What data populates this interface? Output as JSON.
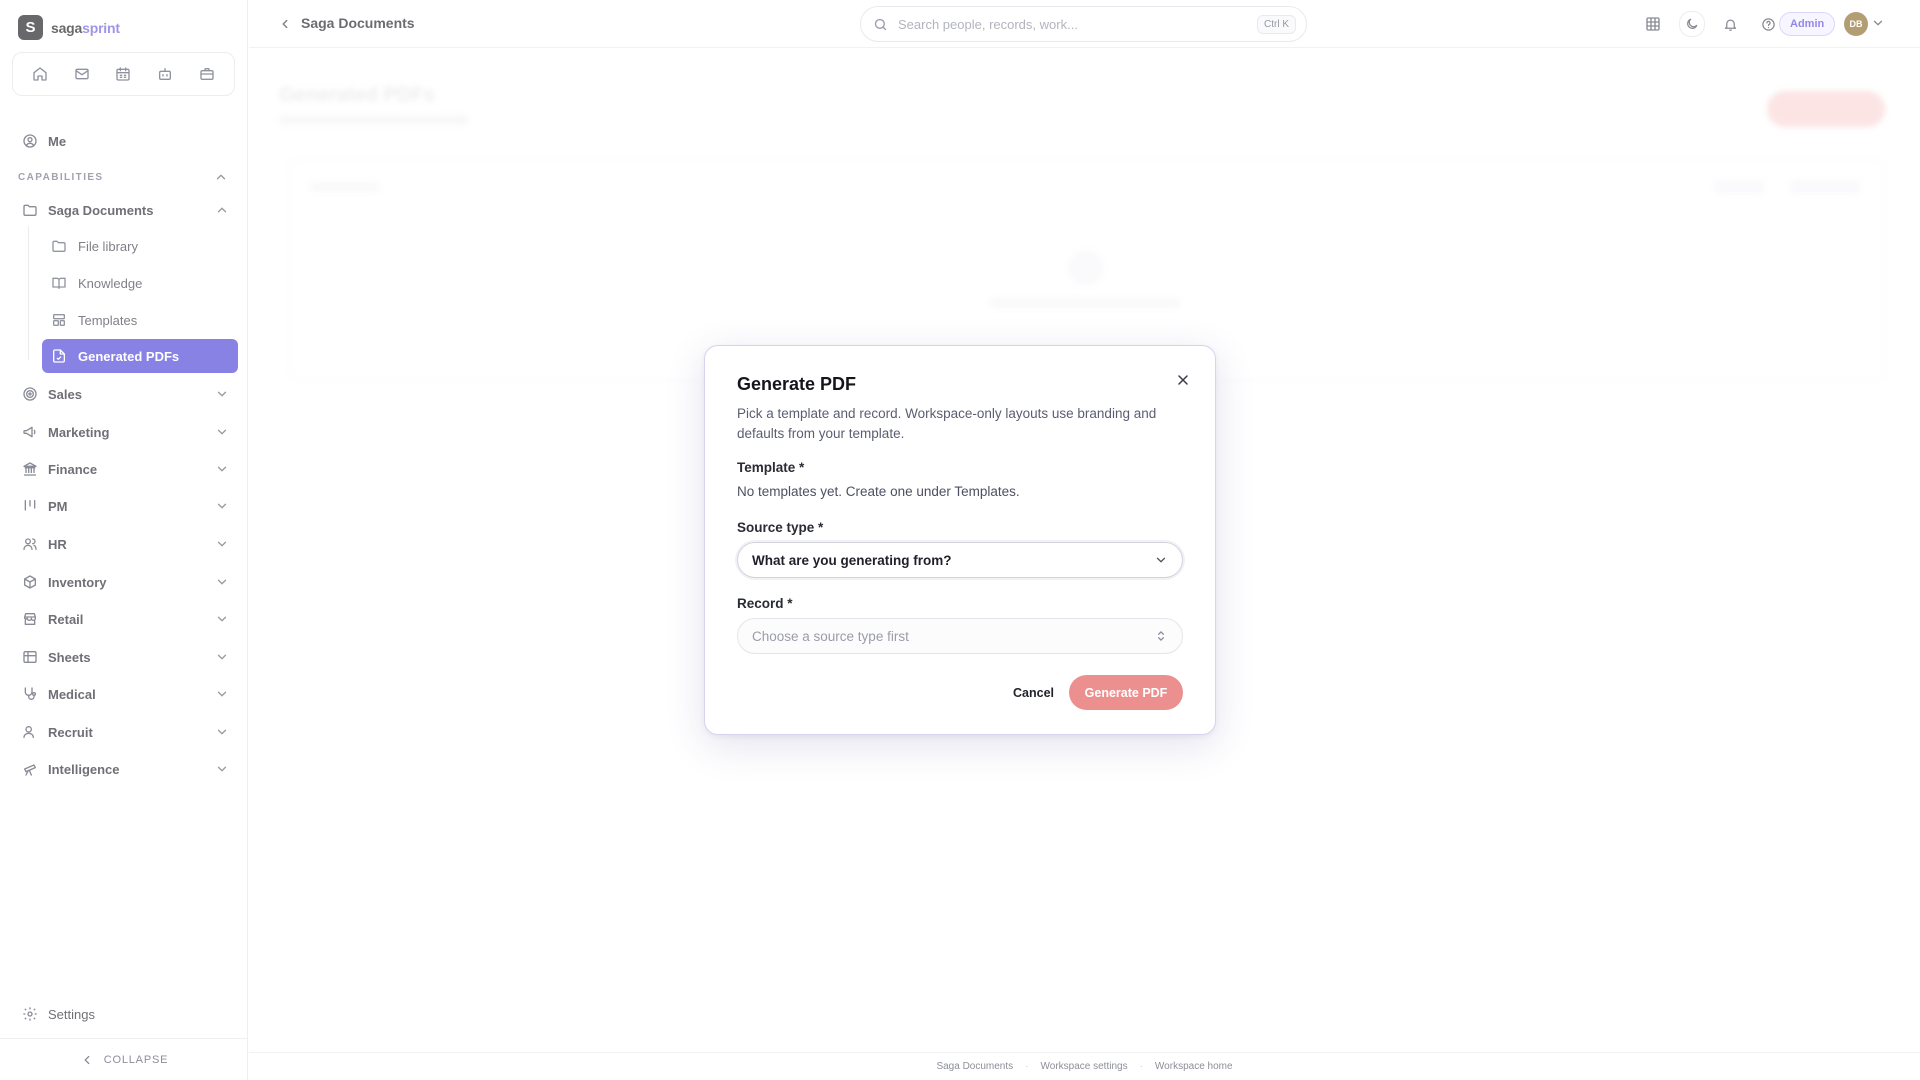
{
  "brand": {
    "mark": "S",
    "name_primary": "saga",
    "name_accent": "sprint"
  },
  "quickbar": {
    "items": [
      {
        "icon": "home-icon"
      },
      {
        "icon": "mail-icon"
      },
      {
        "icon": "calendar-icon"
      },
      {
        "icon": "bot-icon"
      },
      {
        "icon": "briefcase-icon"
      }
    ]
  },
  "sidebar": {
    "me_label": "Me",
    "section_label": "CAPABILITIES",
    "saga_documents_label": "Saga Documents",
    "sub_items": [
      {
        "label": "File library",
        "icon": "folder-icon"
      },
      {
        "label": "Knowledge",
        "icon": "book-icon"
      },
      {
        "label": "Templates",
        "icon": "template-icon"
      },
      {
        "label": "Generated PDFs",
        "icon": "file-pdf-icon",
        "active": true
      }
    ],
    "items": [
      {
        "label": "Sales",
        "icon": "target-icon"
      },
      {
        "label": "Marketing",
        "icon": "megaphone-icon"
      },
      {
        "label": "Finance",
        "icon": "bank-icon"
      },
      {
        "label": "PM",
        "icon": "kanban-icon"
      },
      {
        "label": "HR",
        "icon": "users-icon"
      },
      {
        "label": "Inventory",
        "icon": "package-icon"
      },
      {
        "label": "Retail",
        "icon": "store-icon"
      },
      {
        "label": "Sheets",
        "icon": "table-icon"
      },
      {
        "label": "Medical",
        "icon": "stethoscope-icon"
      },
      {
        "label": "Recruit",
        "icon": "user-plus-icon"
      },
      {
        "label": "Intelligence",
        "icon": "telescope-icon"
      }
    ],
    "settings_label": "Settings",
    "collapse_label": "COLLAPSE"
  },
  "topbar": {
    "title": "Saga Documents",
    "search_placeholder": "Search people, records, work...",
    "search_shortcut": "Ctrl K",
    "admin_label": "Admin",
    "avatar_initials": "DB"
  },
  "background_page": {
    "title": "Generated PDFs"
  },
  "modal": {
    "title": "Generate PDF",
    "description": "Pick a template and record. Workspace-only layouts use branding and defaults from your template.",
    "template_label": "Template *",
    "template_note": "No templates yet. Create one under Templates.",
    "source_type_label": "Source type *",
    "source_type_value": "What are you generating from?",
    "record_label": "Record *",
    "record_placeholder": "Choose a source type first",
    "cancel_label": "Cancel",
    "generate_label": "Generate PDF"
  },
  "footer": {
    "links": [
      "Saga Documents",
      "Workspace settings",
      "Workspace home"
    ]
  },
  "colors": {
    "accent": "#4a3fd8",
    "generate_button": "#ec8f8f",
    "admin_pill_text": "#5a47d9",
    "avatar_bg": "#8a6a2a"
  }
}
